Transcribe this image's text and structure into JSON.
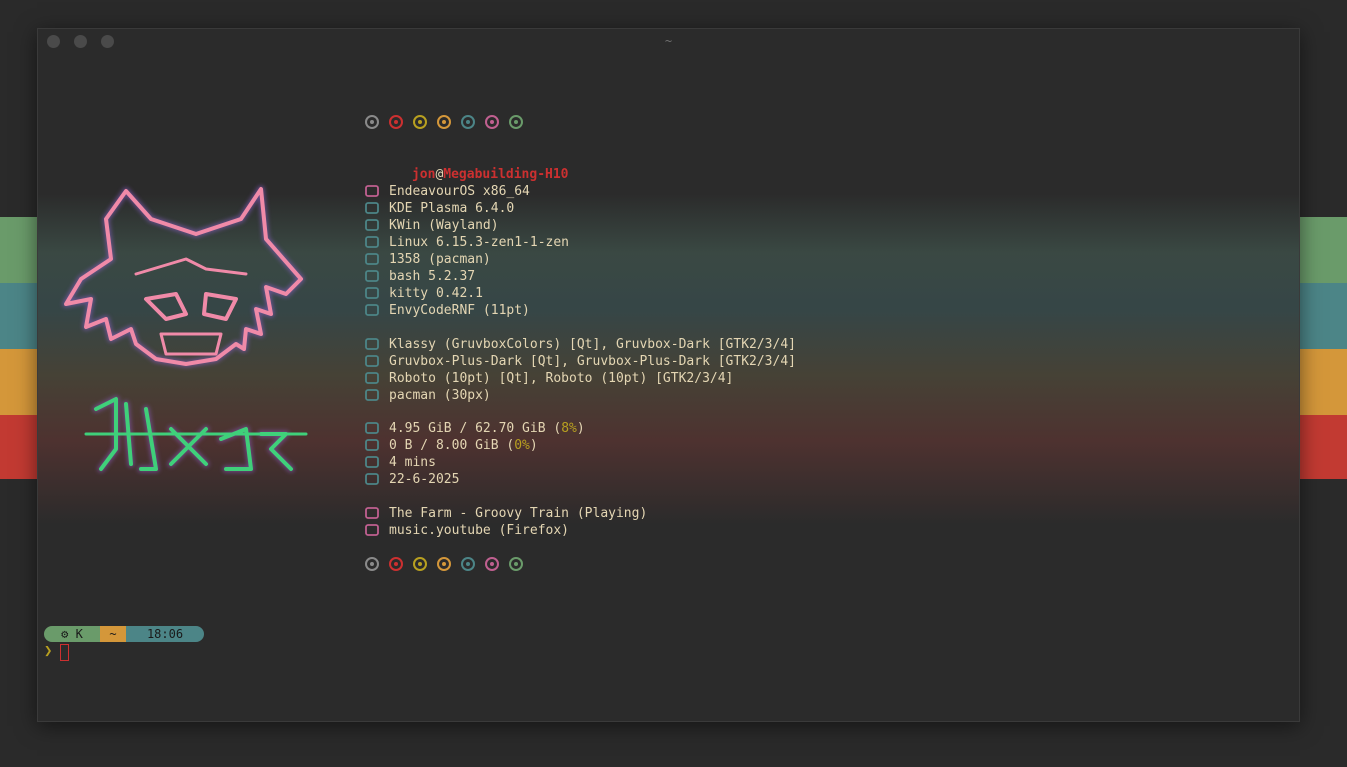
{
  "window": {
    "title": "~"
  },
  "info": {
    "user": "jon",
    "at": "@",
    "host": "Megabuilding-H10",
    "rows": [
      {
        "icon": "endeavouros-icon",
        "text": "EndeavourOS x86_64"
      },
      {
        "icon": "kde-icon",
        "text": "KDE Plasma 6.4.0"
      },
      {
        "icon": "window-icon",
        "text": "KWin (Wayland)"
      },
      {
        "icon": "gear-icon",
        "text": "Linux 6.15.3-zen1-1-zen"
      },
      {
        "icon": "package-icon",
        "text": "1358 (pacman)"
      },
      {
        "icon": "shell-icon",
        "text": "bash 5.2.37"
      },
      {
        "icon": "terminal-icon",
        "text": "kitty 0.42.1"
      },
      {
        "icon": "font-icon",
        "text": "EnvyCodeRNF (11pt)"
      },
      {
        "icon": "paint-icon",
        "text": "Klassy (GruvboxColors) [Qt], Gruvbox-Dark [GTK2/3/4]"
      },
      {
        "icon": "icons-icon",
        "text": "Gruvbox-Plus-Dark [Qt], Gruvbox-Plus-Dark [GTK2/3/4]"
      },
      {
        "icon": "font-size-icon",
        "text": "Roboto (10pt) [Qt], Roboto (10pt) [GTK2/3/4]"
      },
      {
        "icon": "cursor-icon",
        "text": "pacman (30px)"
      },
      {
        "icon": "memory-icon",
        "text": "4.95 GiB / 62.70 GiB (",
        "pct": "8%",
        "end": ")"
      },
      {
        "icon": "swap-icon",
        "text": "0 B / 8.00 GiB (",
        "pct": "0%",
        "end": ")"
      },
      {
        "icon": "clock-icon",
        "text": "4 mins"
      },
      {
        "icon": "calendar-icon",
        "text": "22-6-2025"
      },
      {
        "icon": "music-icon",
        "text": "The Farm - Groovy Train (Playing)"
      },
      {
        "icon": "player-icon",
        "text": "music.youtube (Firefox)"
      }
    ]
  },
  "colors": {
    "dots": [
      "#8a8a8a",
      "#cc3030",
      "#b8a020",
      "#d4973a",
      "#4c8587",
      "#c06090",
      "#6a9b6a"
    ],
    "icon_pink": "#c06090",
    "icon_teal": "#4c8587",
    "icon_yellow": "#d4973a"
  },
  "prompt": {
    "seg1": "K",
    "seg2": "~",
    "seg3": "18:06",
    "caret": "❯"
  }
}
